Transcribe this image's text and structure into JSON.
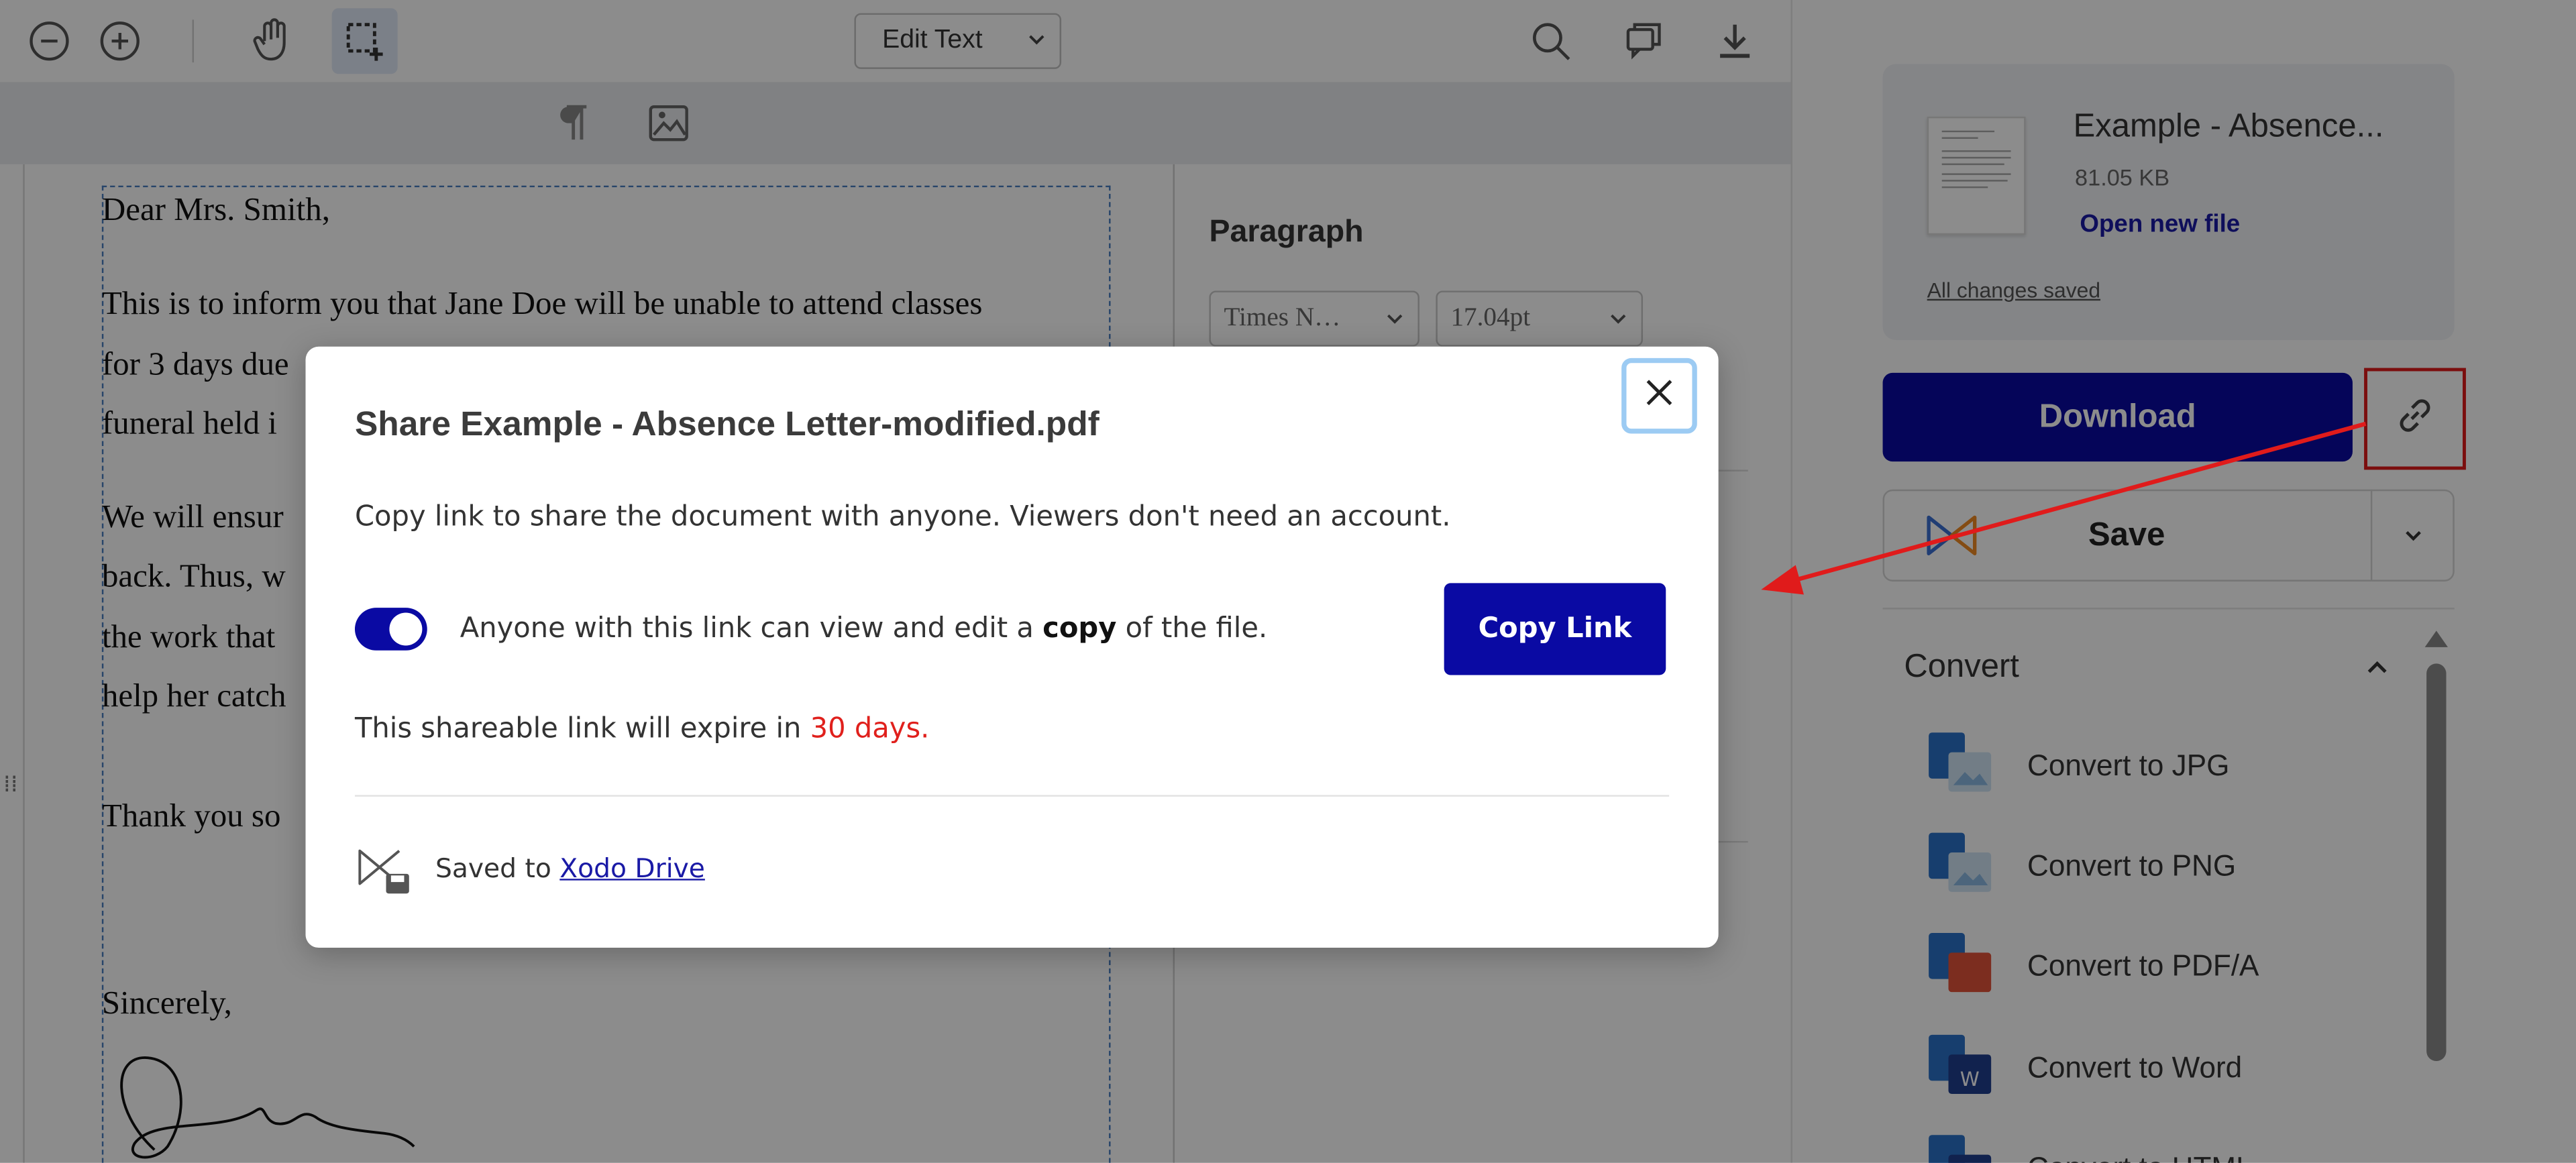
{
  "toolbar": {
    "mode_select": "Edit Text",
    "icons": [
      "zoom-out-icon",
      "zoom-in-icon",
      "pan-hand-icon",
      "select-region-icon",
      "search-icon",
      "comments-icon",
      "download-icon"
    ],
    "subtools": [
      "paragraph-icon",
      "image-icon"
    ]
  },
  "document": {
    "lines": [
      "Dear Mrs. Smith,",
      "This is to inform you that Jane Doe will be unable to attend classes",
      "for 3 days due",
      "funeral held i",
      "We will ensur",
      "back. Thus, w",
      "the work that",
      "help her catch",
      "Thank you so",
      "Sincerely,"
    ]
  },
  "paragraph_panel": {
    "title": "Paragraph",
    "font": "Times N…",
    "size": "17.04pt"
  },
  "sidebar": {
    "file_name": "Example - Absence...",
    "file_size": "81.05 KB",
    "open_new": "Open new file",
    "changes_saved": "All changes saved",
    "download": "Download",
    "save": "Save",
    "convert_title": "Convert",
    "convert_items": [
      "Convert to JPG",
      "Convert to PNG",
      "Convert to PDF/A",
      "Convert to Word",
      "Convert to HTML"
    ]
  },
  "modal": {
    "title": "Share Example - Absence Letter-modified.pdf",
    "description": "Copy link to share the document with anyone. Viewers don't need an account.",
    "toggle_before": "Anyone with this link can view and edit a ",
    "toggle_bold": "copy",
    "toggle_after": " of the file.",
    "copy_button": "Copy Link",
    "expire_text": "This shareable link will expire in ",
    "expire_days": "30 days.",
    "saved_prefix": "Saved to ",
    "saved_link": "Xodo Drive",
    "toggle_on": true
  },
  "colors": {
    "accent": "#0a0aa3",
    "annotation": "#e01b1b",
    "expire": "#e0201c"
  }
}
